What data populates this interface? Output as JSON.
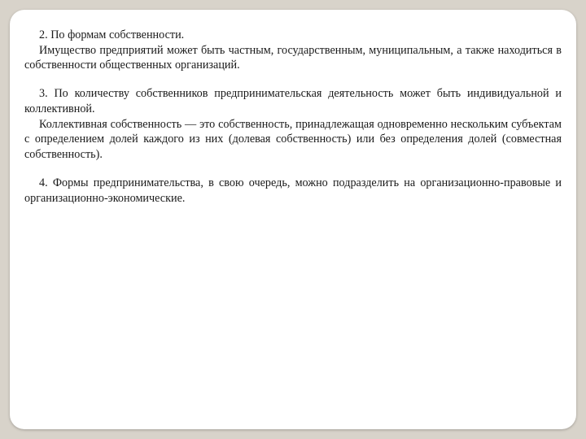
{
  "content": {
    "p1_l1": "2. По формам собственности.",
    "p1_l2": "Имущество предприятий может быть частным, государственным, муниципальным, а также находиться в собственности общественных организаций.",
    "p2_l1": "3. По количеству собственников предпринимательская деятельность может быть индивидуальной и коллективной.",
    "p2_l2": "Коллективная собственность — это собственность, принадлежащая одновременно нескольким субъектам с определением долей каждого из них (долевая собственность) или без определения долей (совместная собственность).",
    "p3": "4. Формы предпринимательства, в свою очередь, можно подразделить на организационно-правовые и организационно-экономические."
  }
}
